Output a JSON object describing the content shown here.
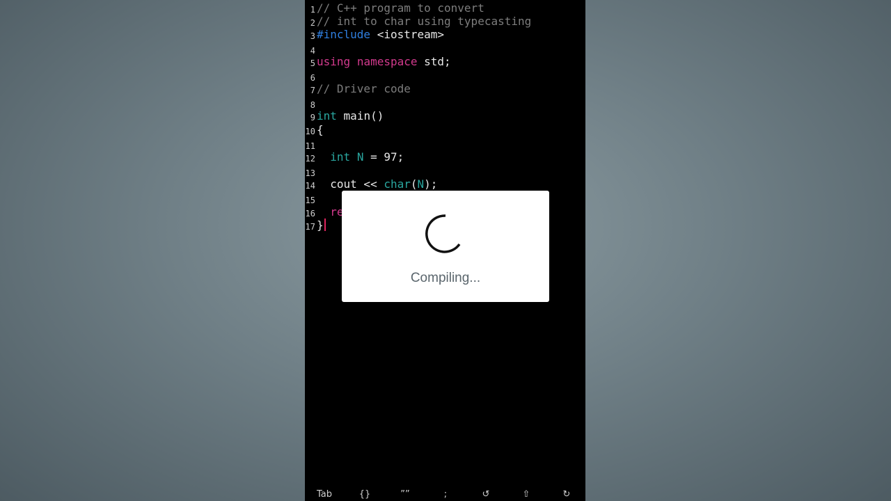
{
  "editor": {
    "lines": [
      {
        "num": "1",
        "tokens": [
          {
            "t": "// C++ program to convert",
            "c": "comment"
          }
        ]
      },
      {
        "num": "2",
        "tokens": [
          {
            "t": "// int to char using typecasting",
            "c": "comment"
          }
        ]
      },
      {
        "num": "3",
        "tokens": [
          {
            "t": "#include",
            "c": "pre"
          },
          {
            "t": " <iostream>",
            "c": "plain"
          }
        ]
      },
      {
        "num": "4",
        "tokens": []
      },
      {
        "num": "5",
        "tokens": [
          {
            "t": "using",
            "c": "kw"
          },
          {
            "t": " ",
            "c": "plain"
          },
          {
            "t": "namespace",
            "c": "kw"
          },
          {
            "t": " std;",
            "c": "plain"
          }
        ]
      },
      {
        "num": "6",
        "tokens": []
      },
      {
        "num": "7",
        "tokens": [
          {
            "t": "// Driver code",
            "c": "comment"
          }
        ]
      },
      {
        "num": "8",
        "tokens": []
      },
      {
        "num": "9",
        "tokens": [
          {
            "t": "int",
            "c": "type"
          },
          {
            "t": " main()",
            "c": "plain"
          }
        ]
      },
      {
        "num": "10",
        "tokens": [
          {
            "t": "{",
            "c": "plain"
          }
        ]
      },
      {
        "num": "11",
        "tokens": []
      },
      {
        "num": "12",
        "tokens": [
          {
            "t": "  ",
            "c": "plain"
          },
          {
            "t": "int",
            "c": "type"
          },
          {
            "t": " ",
            "c": "plain"
          },
          {
            "t": "N",
            "c": "type"
          },
          {
            "t": " = 97;",
            "c": "plain"
          }
        ]
      },
      {
        "num": "13",
        "tokens": []
      },
      {
        "num": "14",
        "tokens": [
          {
            "t": "  cout << ",
            "c": "plain"
          },
          {
            "t": "char",
            "c": "type"
          },
          {
            "t": "(",
            "c": "plain"
          },
          {
            "t": "N",
            "c": "type"
          },
          {
            "t": ");",
            "c": "plain"
          }
        ]
      },
      {
        "num": "15",
        "tokens": []
      },
      {
        "num": "16",
        "tokens": [
          {
            "t": "  re",
            "c": "kw"
          }
        ]
      },
      {
        "num": "17",
        "tokens": [
          {
            "t": "}",
            "c": "plain"
          }
        ],
        "cursor": true
      }
    ]
  },
  "toolbar": {
    "keys": [
      {
        "label": "Tab",
        "name": "tab-key"
      },
      {
        "label": "{}",
        "name": "braces-key"
      },
      {
        "label": "””",
        "name": "quotes-key"
      },
      {
        "label": ";",
        "name": "semicolon-key"
      },
      {
        "label": "↺",
        "name": "undo-key"
      },
      {
        "label": "⇧",
        "name": "shift-key"
      },
      {
        "label": "↻",
        "name": "redo-key"
      }
    ]
  },
  "dialog": {
    "message": "Compiling...",
    "icon": "loading-spinner-icon"
  }
}
